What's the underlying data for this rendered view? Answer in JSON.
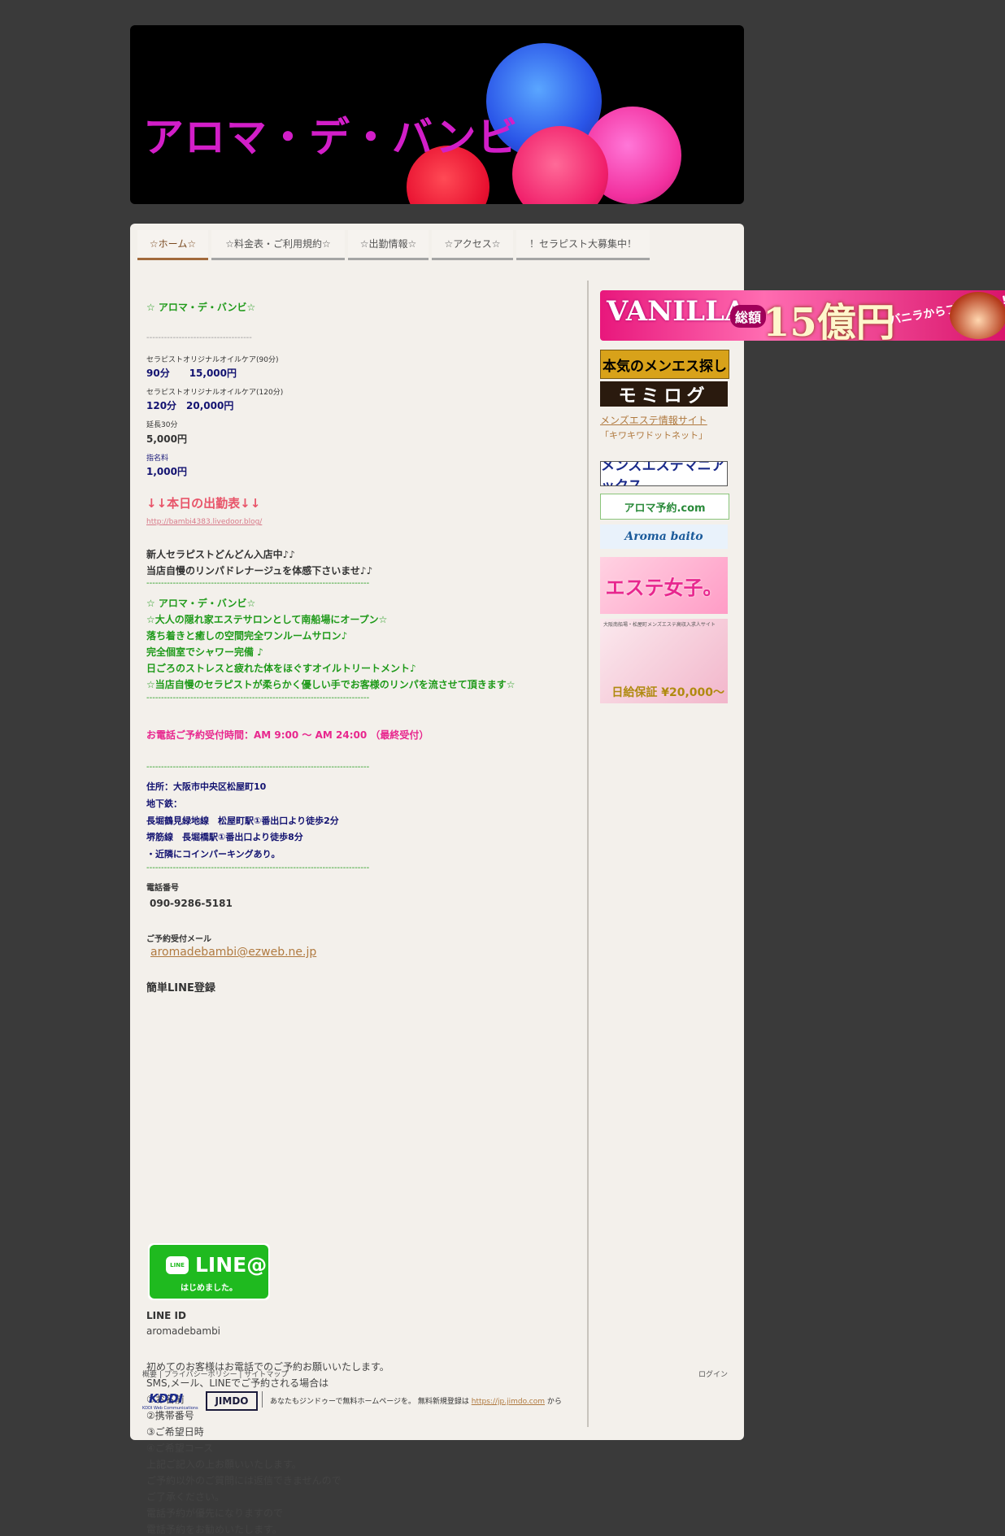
{
  "header": {
    "title": "アロマ・デ・バンビ"
  },
  "nav": {
    "items": [
      {
        "label": "☆ホーム☆"
      },
      {
        "label": "☆料金表・ご利用規約☆"
      },
      {
        "label": "☆出勤情報☆"
      },
      {
        "label": "☆アクセス☆"
      },
      {
        "label": "！セラピスト大募集中！"
      }
    ]
  },
  "main": {
    "shop_heading": "☆ アロマ・デ・バンビ☆",
    "sep_grey": "------------------------------------",
    "price": [
      {
        "course": "セラピストオリジナルオイルケア(90分)",
        "value": "90分　　15,000円"
      },
      {
        "course": "セラピストオリジナルオイルケア(120分)",
        "value": "120分　20,000円"
      },
      {
        "course": "延長30分",
        "value": "5,000円"
      },
      {
        "course": "指名料",
        "value": "1,000円"
      }
    ],
    "schedule_heading": "↓↓本日の出勤表↓↓",
    "schedule_link": "http://bambi4383.livedoor.blog/",
    "intro": [
      "新人セラピストどんどん入店中♪♪",
      "当店自慢のリンパドレナージュを体感下さいませ♪♪"
    ],
    "sep_green": "----------------------------------------------------------------------------",
    "features": [
      "☆ アロマ・デ・バンビ☆",
      "☆大人の隠れ家エステサロンとして南船場にオープン☆",
      "落ち着きと癒しの空間完全ワンルームサロン♪",
      "完全個室でシャワー完備 ♪",
      "日ごろのストレスと疲れた体をほぐすオイルトリートメント♪",
      "☆当店自慢のセラピストが柔らかく優しい手でお客様のリンパを流させて頂きます☆"
    ],
    "hours": "お電話ご予約受付時間：AM 9:00 ～ AM 24:00 （最終受付）",
    "access": [
      "住所：大阪市中央区松屋町10",
      "地下鉄：",
      "長堀鶴見緑地線　松屋町駅①番出口より徒歩2分",
      "堺筋線　長堀橋駅①番出口より徒歩8分",
      "・近隣にコインパーキングあり。"
    ],
    "phone_label": "電話番号",
    "phone": "090-9286-5181",
    "mail_label": "ご予約受付メール",
    "mail": "aromadebambi@ezweb.ne.jp",
    "line_heading": "簡単LINE登録",
    "line_badge": {
      "logo": "LINE@",
      "bubble": "LINE",
      "sub": "はじめました。"
    },
    "line_id_label": "LINE ID",
    "line_id": "aromadebambi",
    "notes": [
      "初めてのお客様はお電話でのご予約お願いいたします。",
      "SMS,メール、LINEでご予約される場合は",
      "①お名前",
      "②携帯番号",
      "③ご希望日時",
      "④ご希望コース",
      "上記ご記入の上お願いいたします。",
      "ご予約以外のご質問には返信できませんので",
      "ご了承ください。",
      "電話予約が優先になりますので",
      "電話予約をお勧めいたします。"
    ]
  },
  "sidebar": {
    "vanilla": {
      "t1": "VANILLA",
      "t2": "総額",
      "t3": "15億円",
      "t4": "バニラからプレゼント!"
    },
    "menes": "本気のメンエス探し",
    "momi": "モミログ",
    "kiwa_link": "メンズエステ情報サイト",
    "kiwa_sub": "「キワキワドットネット」",
    "mania": "メンズエステマニアックス",
    "aroma_yoyaku": "アロマ予約.com",
    "aroma_baito": "Aroma baito",
    "joshi": "エステ女子。",
    "recruit_head": "大阪南船場・松屋町メンズエステ高収入求人サイト",
    "recruit_pay": "日給保証 ¥20,000～"
  },
  "footer": {
    "links": "概要 | プライバシーポリシー | サイトマップ",
    "login": "ログイン",
    "kddi": "KDDI",
    "kddi_sub": "KDDI Web Communications",
    "jimdo": "JIMDO",
    "promo": "あなたもジンドゥーで無料ホームページを。 無料新規登録は",
    "promo_link": "https://jp.jimdo.com",
    "promo_tail": "から"
  }
}
